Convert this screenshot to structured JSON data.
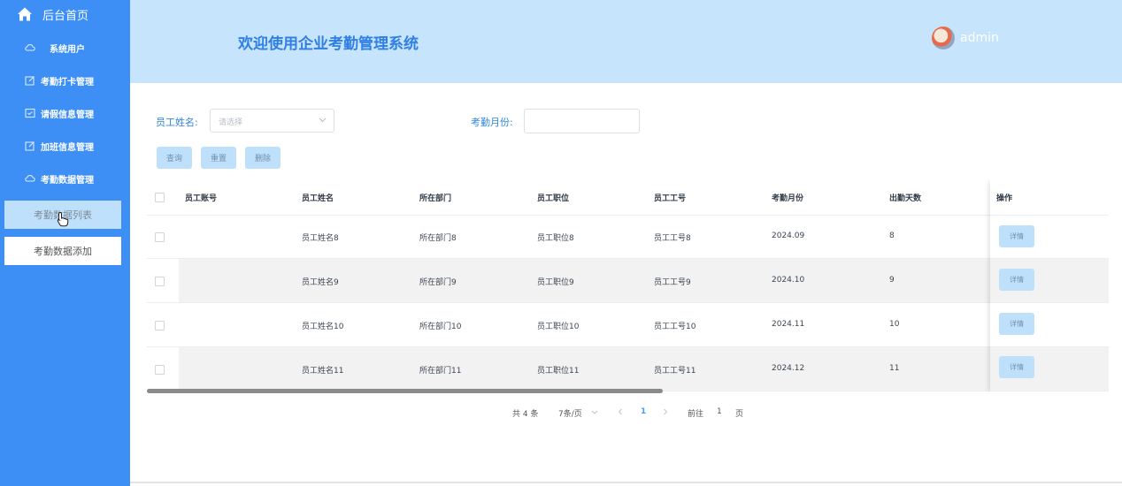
{
  "sidebar": {
    "home_label": "后台首页",
    "menu": [
      {
        "label": "系统用户",
        "icon": "cloud-icon"
      },
      {
        "label": "考勤打卡管理",
        "icon": "edit-icon"
      },
      {
        "label": "请假信息管理",
        "icon": "calendar-icon"
      },
      {
        "label": "加班信息管理",
        "icon": "edit-icon"
      },
      {
        "label": "考勤数据管理",
        "icon": "cloud-icon"
      }
    ],
    "sub": [
      {
        "label": "考勤数据列表",
        "active": true
      },
      {
        "label": "考勤数据添加",
        "active": false
      }
    ]
  },
  "header": {
    "title": "欢迎使用企业考勤管理系统",
    "user": "admin"
  },
  "filters": {
    "name_label": "员工姓名:",
    "name_placeholder": "请选择",
    "month_label": "考勤月份:",
    "month_value": ""
  },
  "buttons": {
    "query": "查询",
    "reset": "重置",
    "delete": "删除"
  },
  "table": {
    "columns": [
      "员工账号",
      "员工姓名",
      "所在部门",
      "员工职位",
      "员工工号",
      "考勤月份",
      "出勤天数",
      "操作"
    ],
    "rows": [
      {
        "account": "",
        "name": "员工姓名8",
        "dept": "所在部门8",
        "position": "员工职位8",
        "no": "员工工号8",
        "month": "2024.09",
        "days": "8",
        "action": "详情"
      },
      {
        "account": "",
        "name": "员工姓名9",
        "dept": "所在部门9",
        "position": "员工职位9",
        "no": "员工工号9",
        "month": "2024.10",
        "days": "9",
        "action": "详情"
      },
      {
        "account": "",
        "name": "员工姓名10",
        "dept": "所在部门10",
        "position": "员工职位10",
        "no": "员工工号10",
        "month": "2024.11",
        "days": "10",
        "action": "详情"
      },
      {
        "account": "",
        "name": "员工姓名11",
        "dept": "所在部门11",
        "position": "员工职位11",
        "no": "员工工号11",
        "month": "2024.12",
        "days": "11",
        "action": "详情"
      }
    ]
  },
  "pagination": {
    "total": "共 4 条",
    "page_size": "7条/页",
    "current_page": "1",
    "goto_prefix": "前往",
    "goto_value": "1",
    "goto_suffix": "页"
  },
  "colors": {
    "sidebar_bg": "#3d8ff5",
    "header_bg": "#c6e4fb",
    "title": "#2f7fe4",
    "button_bg": "#bfe0fb",
    "stripe": "#f2f2f2"
  }
}
